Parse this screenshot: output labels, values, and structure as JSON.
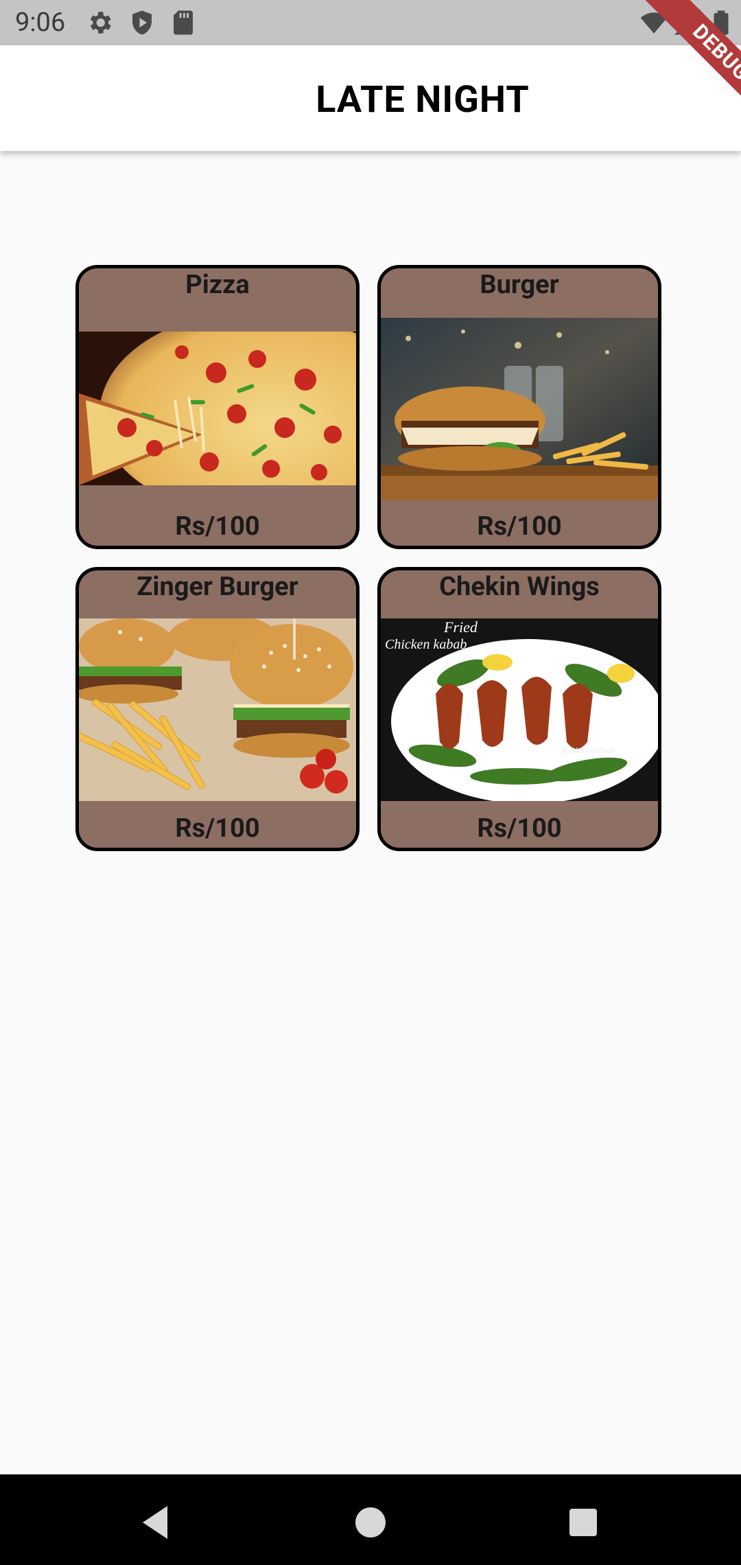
{
  "status_bar": {
    "time": "9:06",
    "left_icons": [
      "gear-icon",
      "shield-play-icon",
      "sd-card-icon"
    ],
    "right_icons": [
      "wifi-icon",
      "signal-icon",
      "battery-icon"
    ]
  },
  "app_bar": {
    "title": "LATE NIGHT"
  },
  "debug_banner": {
    "label": "DEBUG",
    "color": "#b23a3a"
  },
  "menu": {
    "card_color": "#8d6e63",
    "items": [
      {
        "name": "Pizza",
        "price": "Rs/100",
        "image": "pizza-photo"
      },
      {
        "name": "Burger",
        "price": "Rs/100",
        "image": "burger-photo"
      },
      {
        "name": "Zinger Burger",
        "price": "Rs/100",
        "image": "zinger-burger-photo"
      },
      {
        "name": "Chekin Wings",
        "price": "Rs/100",
        "image": "chicken-wings-photo",
        "image_caption": "Fried Chicken kabab",
        "image_watermark": "Ayesha's kitchen"
      }
    ]
  },
  "nav_bar": {
    "buttons": [
      "back-icon",
      "home-icon",
      "recents-icon"
    ]
  }
}
